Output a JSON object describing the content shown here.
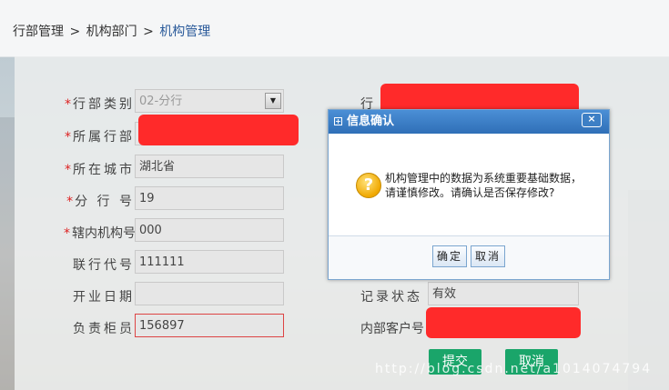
{
  "breadcrumb": {
    "item1": "行部管理",
    "sep1": ">",
    "item2": "机构部门",
    "sep2": ">",
    "current": "机构管理"
  },
  "form": {
    "left_fields": [
      {
        "label": "行部类别",
        "required": true,
        "value": "02-分行",
        "type": "select"
      },
      {
        "label": "所属行部",
        "required": true,
        "value": "",
        "type": "redacted"
      },
      {
        "label": "所在城市",
        "required": true,
        "value": "湖北省",
        "type": "input"
      },
      {
        "label": "分 行 号",
        "required": true,
        "value": "19",
        "type": "input"
      },
      {
        "label": "辖内机构号",
        "required": true,
        "value": "000",
        "type": "input"
      },
      {
        "label": "联行代号",
        "required": false,
        "value": "111111",
        "type": "input"
      },
      {
        "label": "开业日期",
        "required": false,
        "value": "",
        "type": "input"
      },
      {
        "label": "负责柜员",
        "required": false,
        "value": "156897",
        "type": "input"
      }
    ],
    "right_fields": {
      "first_label": "行",
      "status_label": "记录状态",
      "status_value": "有效",
      "customer_label": "内部客户号"
    },
    "submit_label": "提交",
    "cancel_label": "取消"
  },
  "dialog": {
    "title": "信息确认",
    "close_glyph": "×",
    "icon_glyph": "?",
    "message_line1": "机构管理中的数据为系统重要基础数据，",
    "message_line2": "请谨慎修改。请确认是否保存修改?",
    "confirm_label": "确定",
    "cancel_label": "取消"
  },
  "watermark": "http://blog.csdn.net/a1014074794",
  "colors": {
    "accent": "#1aa56a",
    "dialog_header": "#2f6fb7",
    "required": "#dd2222"
  }
}
